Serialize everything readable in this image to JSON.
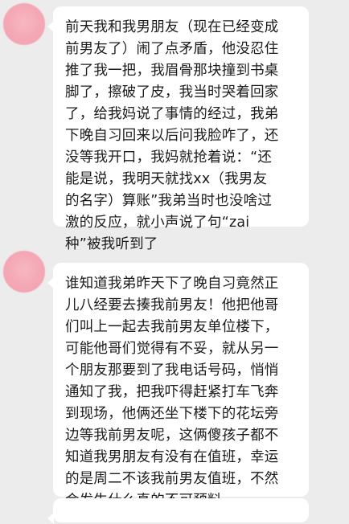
{
  "chat": {
    "messages": [
      {
        "text": "前天我和我男朋友（现在已经变成\n前男友了）闹了点矛盾，他没忍住\n推了我一把，我眉骨那块撞到书桌\n脚了，擦破了皮，我当时哭着回家\n了，给我妈说了事情的经过，我弟\n下晚自习回来以后问我脸咋了，还\n没等我开口，我妈就抢着说：“还\n能是说，我明天就找xx（我男友\n的名字）算账”我弟当时也没啥过\n激的反应，就小声说了句“zai\n种”被我听到了"
      },
      {
        "text": "谁知道我弟昨天下了晚自习竟然正\n儿八经要去揍我前男友！他把他哥\n们叫上一起去我前男友单位楼下，\n可能他哥们觉得有不妥，就从另一\n个朋友那要到了我电话号码，悄悄\n通知了我，把我吓得赶紧打车飞奔\n到现场，他俩还坐下楼下的花坛旁\n边等我前男友呢，这俩傻孩子都不\n知道我男朋友有没有在值班，幸运\n的是周二不该我前男友值班，不然\n会发生什么真的不可预料"
      }
    ]
  }
}
